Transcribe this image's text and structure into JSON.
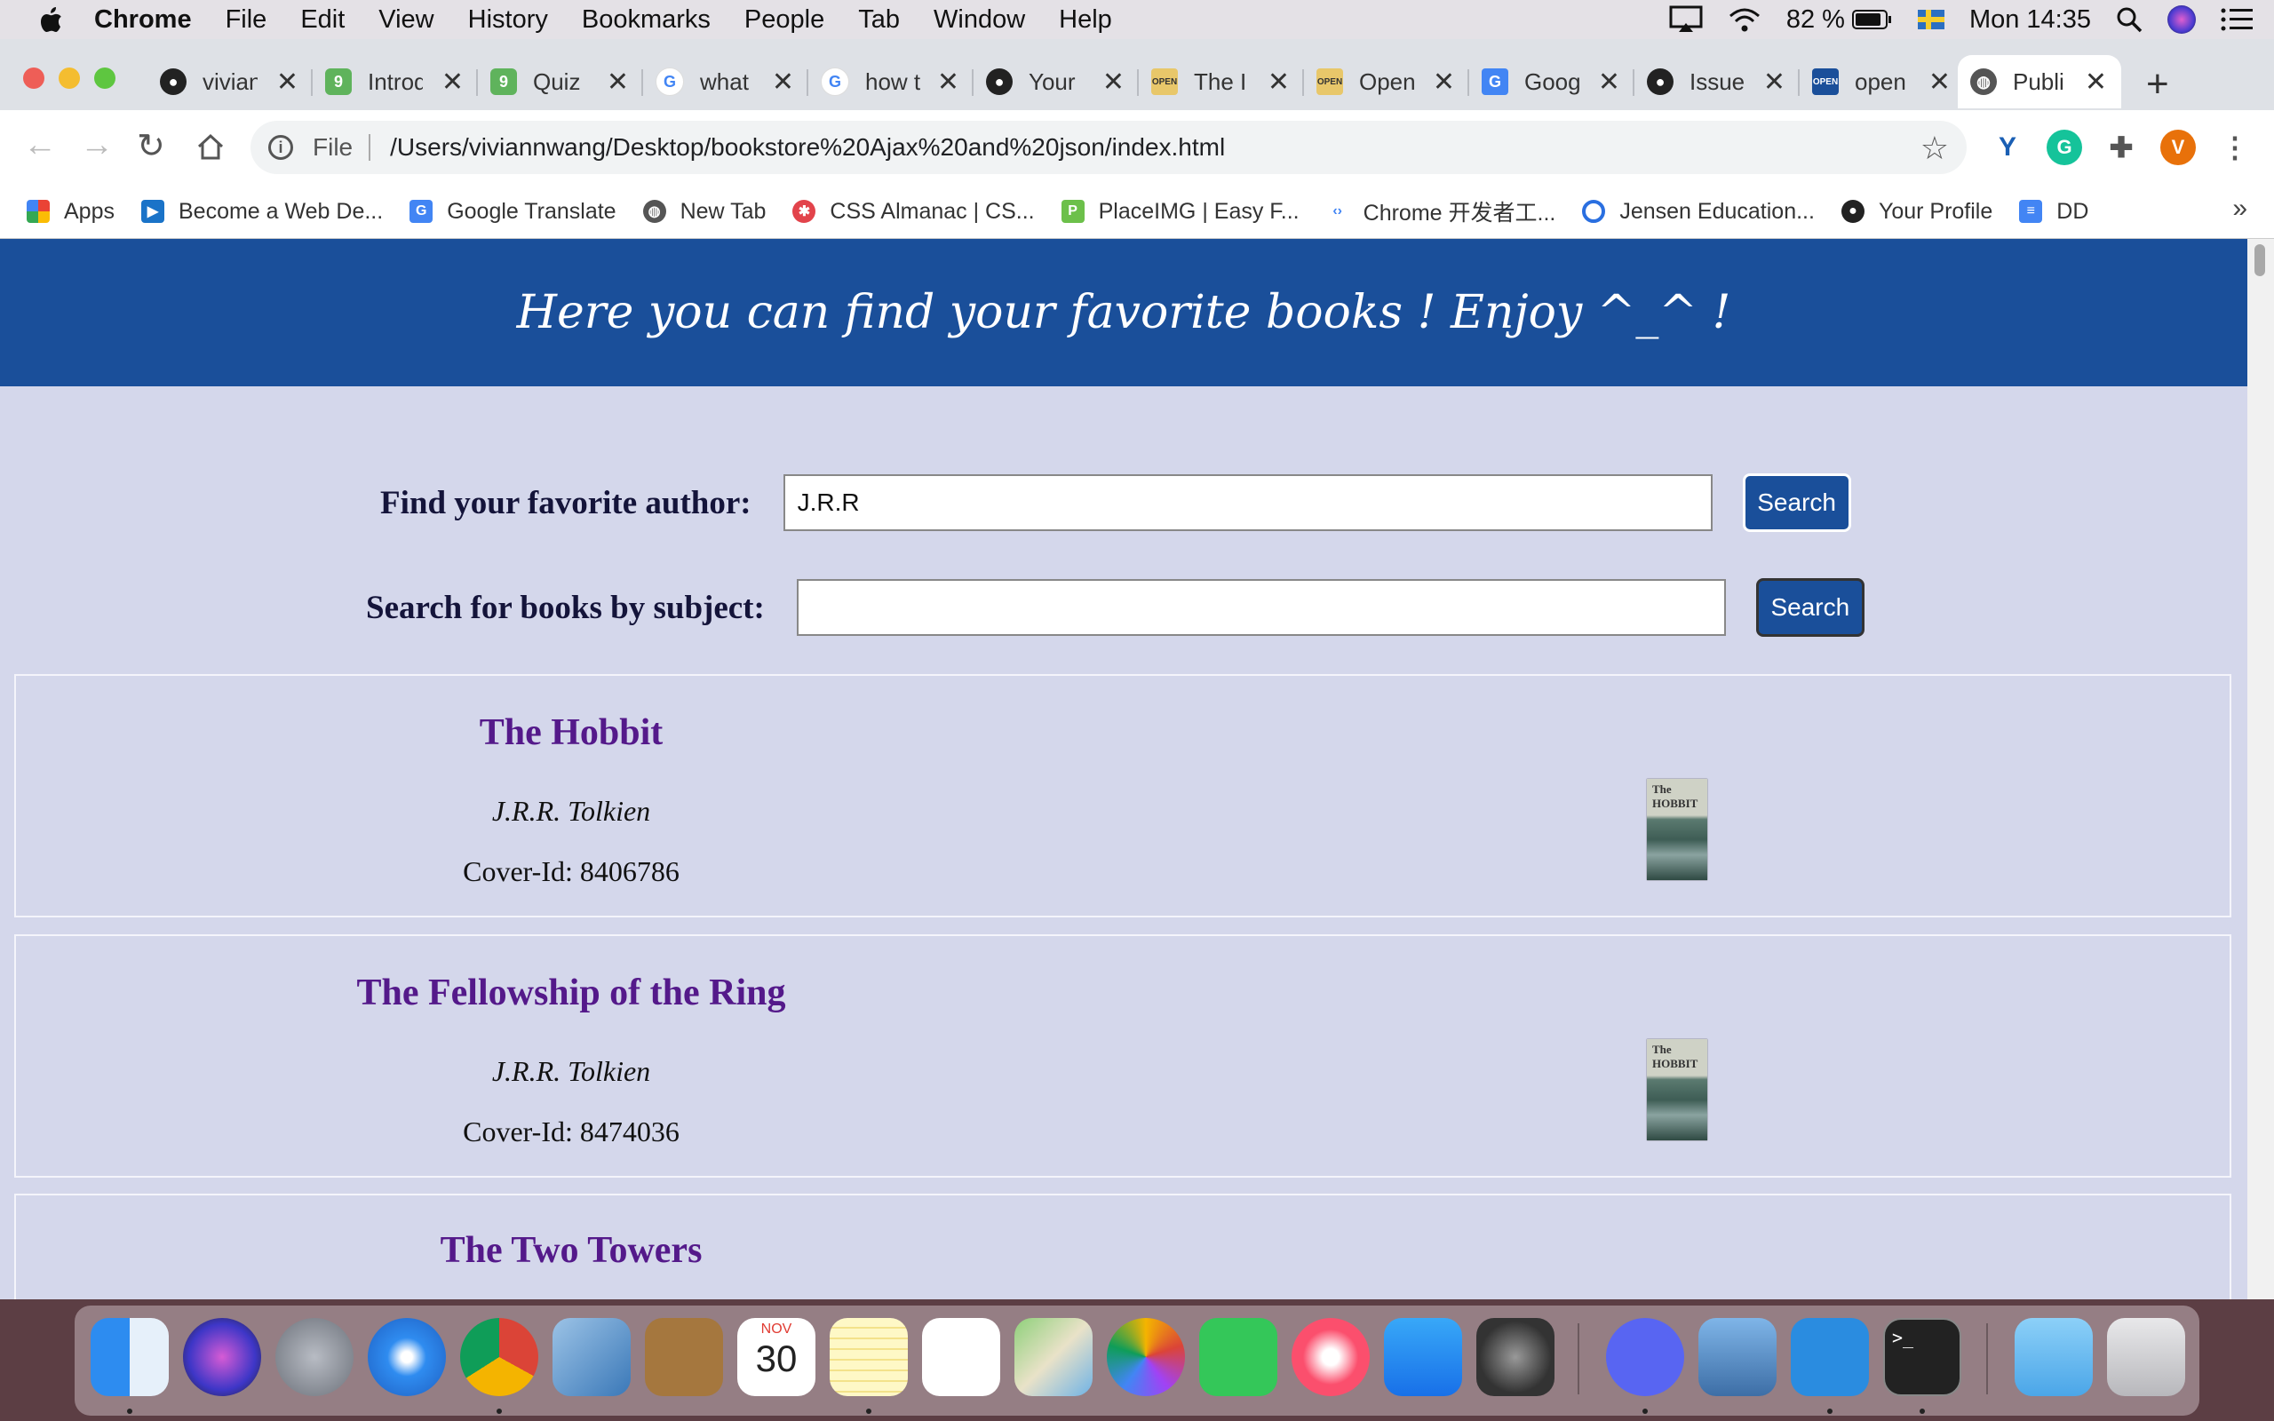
{
  "menubar": {
    "app": "Chrome",
    "items": [
      "File",
      "Edit",
      "View",
      "History",
      "Bookmarks",
      "People",
      "Tab",
      "Window",
      "Help"
    ],
    "battery": "82 %",
    "clock": "Mon 14:35"
  },
  "tabs": [
    {
      "title": "vivian",
      "icon": "github-icon"
    },
    {
      "title": "Introd",
      "icon": "quiz-icon"
    },
    {
      "title": "Quiz",
      "icon": "quiz-icon"
    },
    {
      "title": "what",
      "icon": "google-icon"
    },
    {
      "title": "how t",
      "icon": "google-icon"
    },
    {
      "title": "Your",
      "icon": "github-icon"
    },
    {
      "title": "The I",
      "icon": "open-icon"
    },
    {
      "title": "Open",
      "icon": "open-icon"
    },
    {
      "title": "Goog",
      "icon": "translate-icon"
    },
    {
      "title": "Issue",
      "icon": "github-icon"
    },
    {
      "title": "open",
      "icon": "open-icon"
    },
    {
      "title": "Publi",
      "icon": "globe-icon",
      "active": true
    }
  ],
  "toolbar": {
    "scheme": "File",
    "url": "/Users/viviannwang/Desktop/bookstore%20Ajax%20and%20json/index.html",
    "profile_initial": "V"
  },
  "bookmarks": [
    "Apps",
    "Become a Web De...",
    "Google Translate",
    "New Tab",
    "CSS Almanac | CS...",
    "PlaceIMG | Easy F...",
    "Chrome 开发者工...",
    "Jensen Education...",
    "Your Profile",
    "DD"
  ],
  "page": {
    "banner": "Here you can find your favorite books ! Enjoy ^_^ !",
    "author_search": {
      "label": "Find your favorite author:",
      "value": "J.R.R",
      "button": "Search"
    },
    "subject_search": {
      "label": "Search for books by subject:",
      "value": "",
      "button": "Search"
    },
    "books": [
      {
        "title": "The Hobbit",
        "author": "J.R.R. Tolkien",
        "cover_id": "Cover-Id: 8406786"
      },
      {
        "title": "The Fellowship of the Ring",
        "author": "J.R.R. Tolkien",
        "cover_id": "Cover-Id: 8474036"
      },
      {
        "title": "The Two Towers",
        "author": "",
        "cover_id": ""
      }
    ]
  },
  "dock": {
    "calendar_month": "NOV",
    "calendar_day": "30"
  }
}
